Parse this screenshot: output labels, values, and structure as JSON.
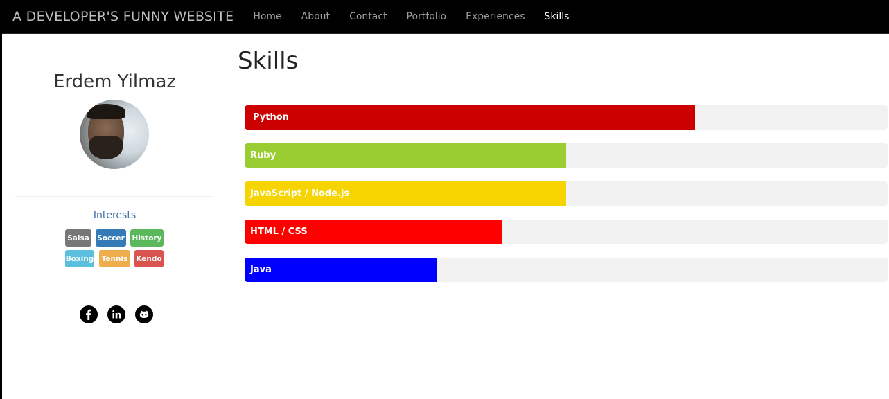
{
  "navbar": {
    "brand": "A DEVELOPER'S FUNNY WEBSITE",
    "items": [
      {
        "label": "Home",
        "active": false
      },
      {
        "label": "About",
        "active": false
      },
      {
        "label": "Contact",
        "active": false
      },
      {
        "label": "Portfolio",
        "active": false
      },
      {
        "label": "Experiences",
        "active": false
      },
      {
        "label": "Skills",
        "active": true
      }
    ]
  },
  "sidebar": {
    "name": "Erdem Yilmaz",
    "interests_title": "Interests",
    "interests": [
      {
        "label": "Salsa",
        "color": "#777777"
      },
      {
        "label": "Soccer",
        "color": "#337ab7"
      },
      {
        "label": "History",
        "color": "#5cb85c"
      },
      {
        "label": "Boxing",
        "color": "#5bc0de"
      },
      {
        "label": "Tennis",
        "color": "#f0ad4e"
      },
      {
        "label": "Kendo",
        "color": "#d9534f"
      }
    ],
    "social": [
      {
        "name": "facebook-icon"
      },
      {
        "name": "linkedin-icon"
      },
      {
        "name": "github-icon"
      }
    ]
  },
  "main": {
    "title": "Skills",
    "skills": [
      {
        "label": "Python",
        "level": 70,
        "color": "#cc0000"
      },
      {
        "label": "Ruby",
        "level": 50,
        "color": "#9acd32"
      },
      {
        "label": "JavaScript / Node.js",
        "level": 50,
        "color": "#f5d400"
      },
      {
        "label": "HTML / CSS",
        "level": 40,
        "color": "#ff0000"
      },
      {
        "label": "Java",
        "level": 30,
        "color": "#0000ff"
      }
    ]
  }
}
